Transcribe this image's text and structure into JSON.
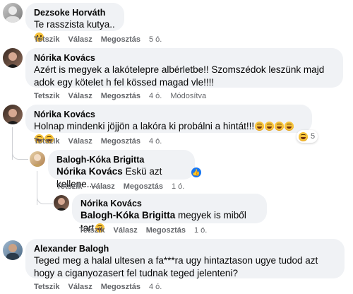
{
  "comments": [
    {
      "author": "Dezsoke Horváth",
      "text": "Te rasszista kutya..",
      "emoji": "sad-face-icon",
      "actions": {
        "like": "Tetszik",
        "reply": "Válasz",
        "share": "Megosztás",
        "time": "5 ó."
      }
    },
    {
      "author": "Nórika Kovács",
      "text": "Azért is megyek a lakótelepre albérletbe!! Szomszédok leszünk majd adok egy kötelet h fel kössed magad vle!!!!",
      "actions": {
        "like": "Tetszik",
        "reply": "Válasz",
        "share": "Megosztás",
        "time": "4 ó.",
        "edited": "Módosítva"
      }
    },
    {
      "author": "Nórika Kovács",
      "text": "Holnap mindenki jöjjön a lakóra ki probálni a hintát!!!",
      "emoji": "laughing-tears-icon",
      "reaction": {
        "icon": "haha-reaction-icon",
        "count": "5"
      },
      "actions": {
        "like": "Tetszik",
        "reply": "Válasz",
        "share": "Megosztás",
        "time": "4 ó."
      }
    },
    {
      "author": "Balogh-Kóka Brigitta",
      "mention": "Nórika Kovács",
      "text": "Eskü azt kellene....",
      "reaction": {
        "icon": "like-reaction-icon"
      },
      "actions": {
        "like": "Tetszik",
        "reply": "Válasz",
        "share": "Megosztás",
        "time": "1 ó."
      }
    },
    {
      "author": "Nórika Kovács",
      "mention": "Balogh-Kóka Brigitta",
      "text": "megyek is miből tart",
      "emoji": "laughing-tears-icon",
      "actions": {
        "like": "Tetszik",
        "reply": "Válasz",
        "share": "Megosztás",
        "time": "1 ó."
      }
    },
    {
      "author": "Alexander Balogh",
      "text": "Teged meg a halal ultesen a fa***ra ugy hintaztason ugye tudod azt hogy a ciganyozasert fel tudnak teged jelenteni?",
      "actions": {
        "like": "Tetszik",
        "reply": "Válasz",
        "share": "Megosztás",
        "time": "4 ó."
      }
    }
  ],
  "colors": {
    "bubble": "#f0f2f5",
    "meta": "#65676b",
    "like": "#1877f2",
    "emoji": "#f7c33b"
  }
}
